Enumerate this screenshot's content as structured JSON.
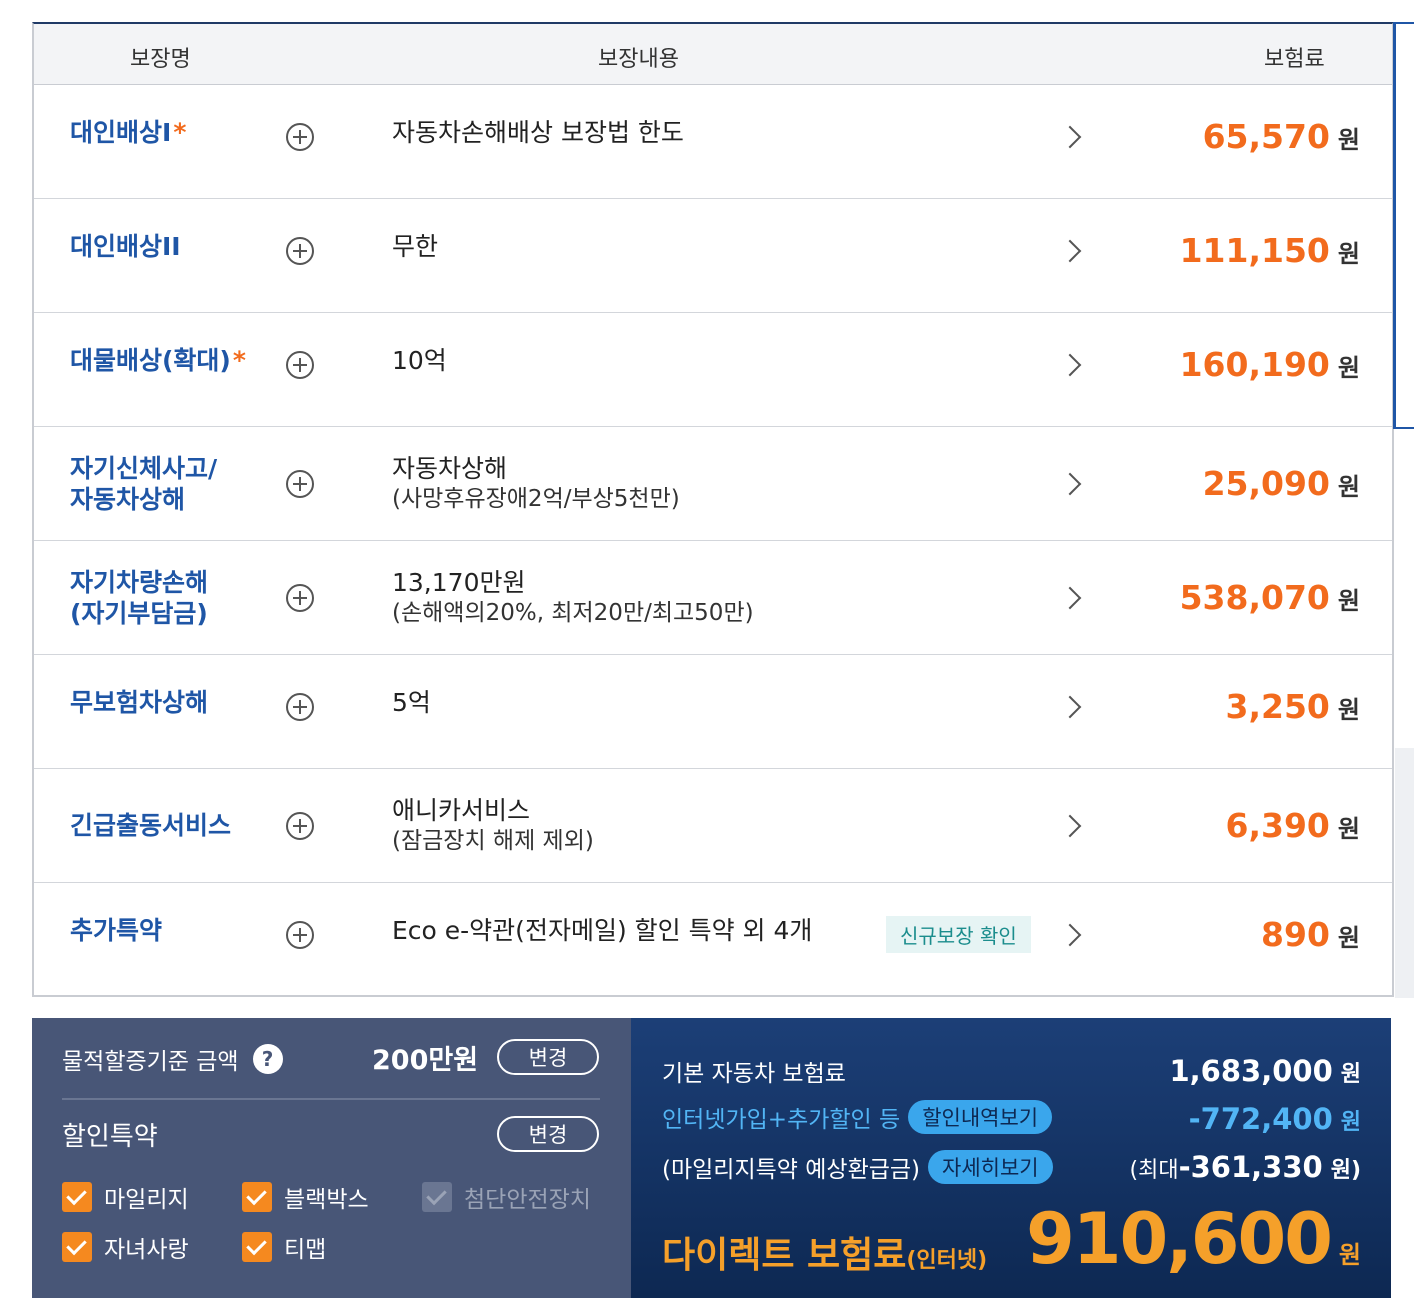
{
  "header": {
    "col_name": "보장명",
    "col_content": "보장내용",
    "col_premium": "보험료"
  },
  "rows": [
    {
      "name": "대인배상I",
      "star": "*",
      "content": "자동차손해배상 보장법 한도",
      "sub": "",
      "premium": "65,570",
      "won": "원"
    },
    {
      "name": "대인배상II",
      "star": "",
      "content": "무한",
      "sub": "",
      "premium": "111,150",
      "won": "원"
    },
    {
      "name": "대물배상(확대)",
      "star": "*",
      "content": "10억",
      "sub": "",
      "premium": "160,190",
      "won": "원"
    },
    {
      "name": "자기신체사고/",
      "name2": "자동차상해",
      "star": "",
      "content": "자동차상해",
      "sub": "(사망후유장애2억/부상5천만)",
      "premium": "25,090",
      "won": "원"
    },
    {
      "name": "자기차량손해",
      "name2": "(자기부담금)",
      "star": "",
      "content": "13,170만원",
      "sub": "(손해액의20%, 최저20만/최고50만)",
      "premium": "538,070",
      "won": "원"
    },
    {
      "name": "무보험차상해",
      "star": "",
      "content": "5억",
      "sub": "",
      "premium": "3,250",
      "won": "원"
    },
    {
      "name": "긴급출동서비스",
      "star": "",
      "content": "애니카서비스",
      "sub": "(잠금장치 해제 제외)",
      "premium": "6,390",
      "won": "원"
    },
    {
      "name": "추가특약",
      "star": "",
      "content": "Eco e-약관(전자메일) 할인 특약 외 4개",
      "sub": "",
      "badge": "신규보장 확인",
      "premium": "890",
      "won": "원"
    }
  ],
  "left_panel": {
    "threshold_label": "물적할증기준 금액",
    "help_icon": "?",
    "threshold_value": "200만원",
    "change_label": "변경",
    "discount_title": "할인특약",
    "change_label2": "변경",
    "checkboxes": [
      {
        "label": "마일리지",
        "checked": true
      },
      {
        "label": "블랙박스",
        "checked": true
      },
      {
        "label": "첨단안전장치",
        "checked": true,
        "disabled": true
      },
      {
        "label": "자녀사랑",
        "checked": true
      },
      {
        "label": "티맵",
        "checked": true
      }
    ]
  },
  "right_panel": {
    "base_label": "기본 자동차 보험료",
    "base_value": "1,683,000",
    "discount_label": "인터넷가입+추가할인 등",
    "discount_btn": "할인내역보기",
    "discount_value": "-772,400",
    "mileage_label": "(마일리지특약 예상환급금)",
    "mileage_btn": "자세히보기",
    "mileage_prefix": "(최대 ",
    "mileage_value": "-361,330",
    "mileage_suffix": "원)",
    "direct_label": "다이렉트 보험료",
    "direct_sub": "(인터넷)",
    "total_value": "910,600",
    "won": "원"
  },
  "colors": {
    "accent_orange": "#f26b1d",
    "name_blue": "#1f56a6",
    "panel_navy": "#0d2852",
    "panel_slate": "#485677"
  }
}
